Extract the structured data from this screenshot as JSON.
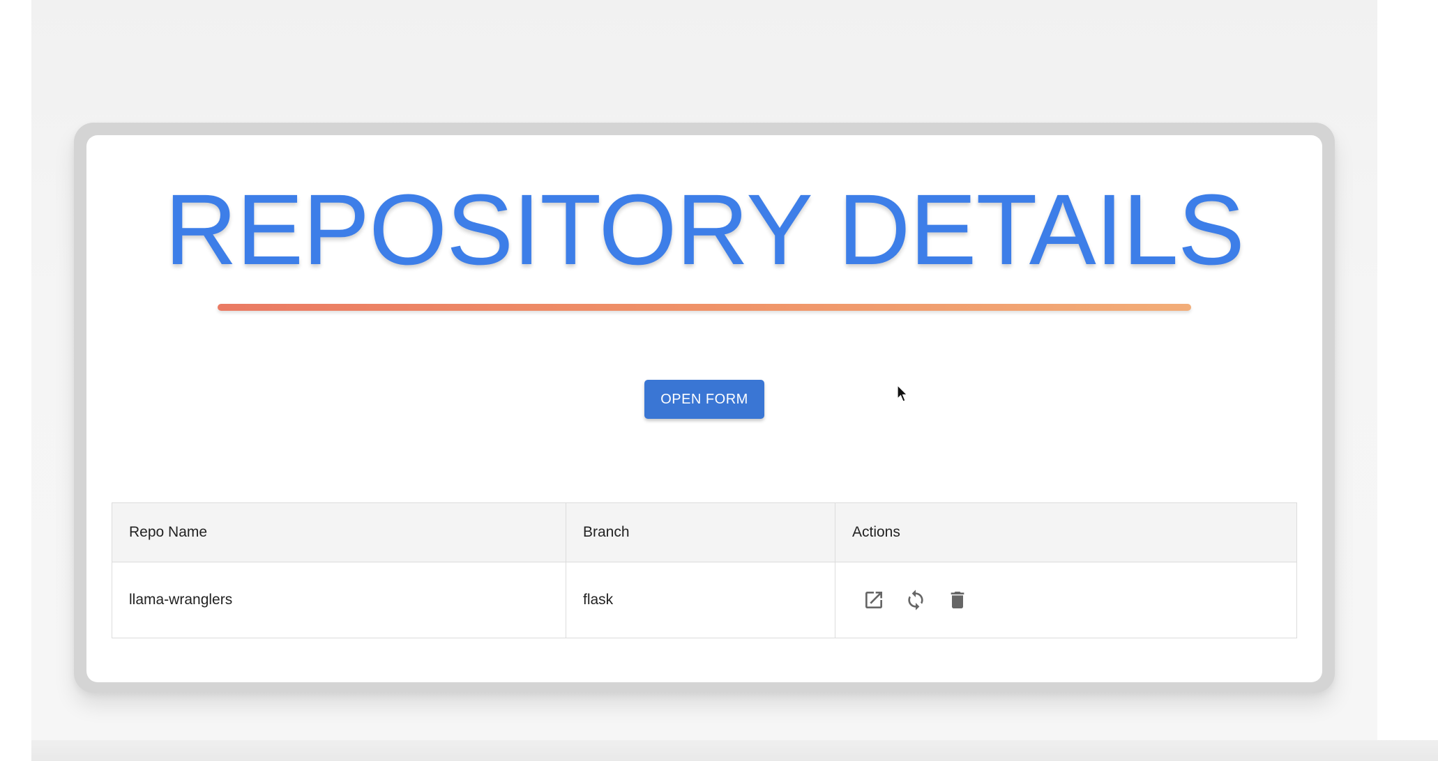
{
  "page": {
    "title": "REPOSITORY DETAILS",
    "open_form_label": "OPEN FORM"
  },
  "table": {
    "headers": [
      "Repo Name",
      "Branch",
      "Actions"
    ],
    "rows": [
      {
        "repo_name": "llama-wranglers",
        "branch": "flask",
        "actions": [
          "open-external-icon",
          "sync-icon",
          "delete-icon"
        ]
      }
    ]
  },
  "colors": {
    "title": "#3d7ee8",
    "button": "#3a76d4",
    "underline_start": "#ea7a63",
    "underline_end": "#f2ad78",
    "icon": "#666666"
  }
}
